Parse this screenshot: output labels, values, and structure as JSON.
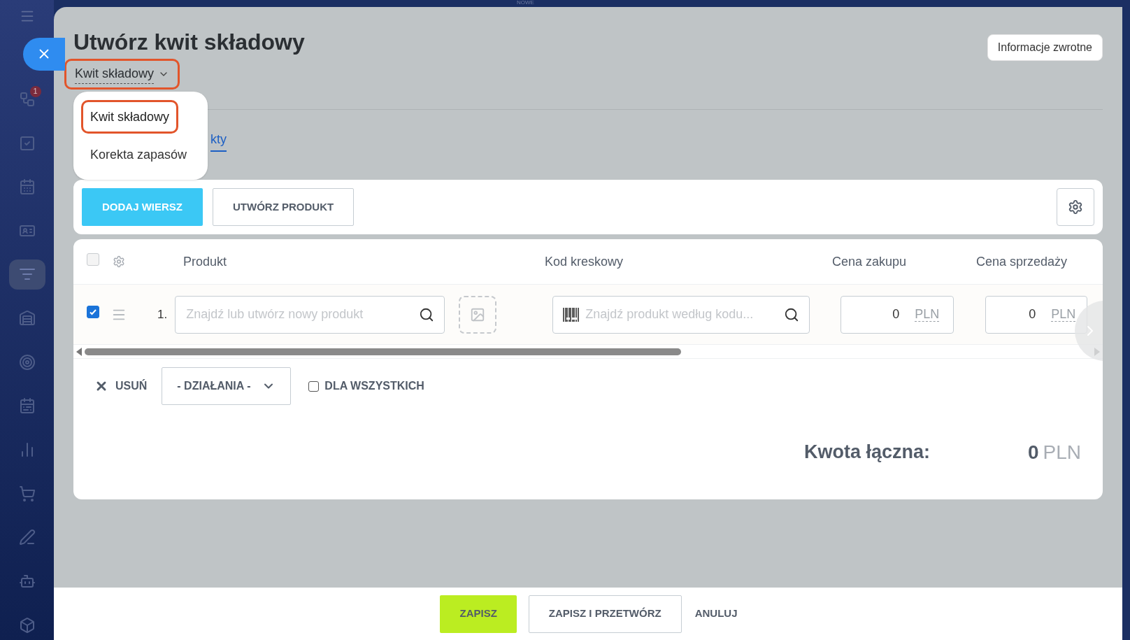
{
  "top_strip": {
    "label": "NOWE"
  },
  "sidebar": {
    "items": [
      {
        "kind": "flow",
        "badge": "1",
        "selected": false
      },
      {
        "kind": "task",
        "selected": false
      },
      {
        "kind": "calendar",
        "selected": false
      },
      {
        "kind": "card",
        "selected": false
      },
      {
        "kind": "filter",
        "selected": true
      },
      {
        "kind": "store",
        "selected": false
      },
      {
        "kind": "target",
        "selected": false
      },
      {
        "kind": "schedule",
        "selected": false
      },
      {
        "kind": "chart",
        "selected": false
      },
      {
        "kind": "cart",
        "selected": false
      },
      {
        "kind": "pen",
        "selected": false
      },
      {
        "kind": "bot",
        "selected": false
      },
      {
        "kind": "box",
        "selected": false
      }
    ]
  },
  "panel": {
    "title": "Utwórz kwit składowy",
    "feedback_button": "Informacje zwrotne",
    "type_selector": {
      "value": "Kwit składowy",
      "expanded": true,
      "highlighted": true
    },
    "type_menu": [
      {
        "label": "Kwit składowy",
        "selected": true,
        "highlighted": true
      },
      {
        "label": "Korekta zapasów",
        "selected": false,
        "highlighted": false
      }
    ],
    "tabs": [
      {
        "label": "kty",
        "selected": true
      }
    ],
    "toolbar": {
      "add_row": "DODAJ WIERSZ",
      "create_product": "UTWÓRZ PRODUKT"
    },
    "table": {
      "columns": [
        "Produkt",
        "Kod kreskowy",
        "Cena zakupu",
        "Cena sprzedaży"
      ],
      "header_checked": false,
      "rows": [
        {
          "checked": true,
          "number": "1.",
          "product_placeholder": "Znajdź lub utwórz nowy produkt",
          "barcode_placeholder": "Znajdź produkt według kodu...",
          "purchase_price": "0",
          "purchase_currency": "PLN",
          "sale_price": "0",
          "sale_currency": "PLN"
        }
      ]
    },
    "actions": {
      "delete": "USUŃ",
      "actions_select": "- DZIAŁANIA -",
      "for_all": "DLA WSZYSTKICH",
      "for_all_checked": false
    },
    "total": {
      "label": "Kwota łączna:",
      "value": "0",
      "currency": "PLN"
    }
  },
  "footer": {
    "save": "ZAPISZ",
    "save_process": "ZAPISZ I PRZETWÓRZ",
    "cancel": "ANULUJ"
  }
}
